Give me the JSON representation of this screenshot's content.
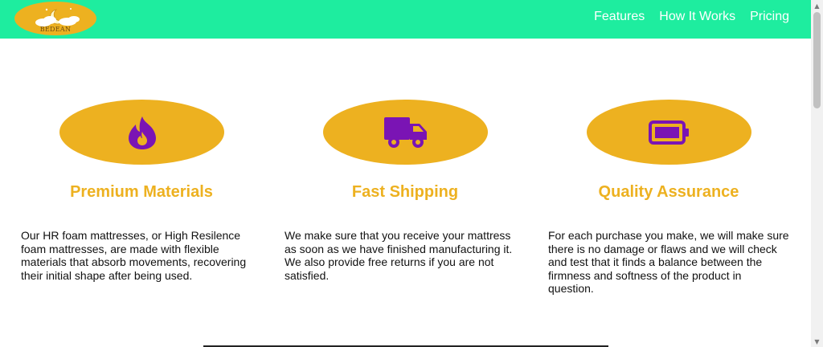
{
  "brand": {
    "logo_text": "BEDEAN",
    "logo_icon": "moon-clouds-logo-icon",
    "colors": {
      "navbar": "#1eed9f",
      "accent": "#edb120",
      "icon": "#7a14b4"
    }
  },
  "nav": {
    "links": [
      {
        "label": "Features"
      },
      {
        "label": "How It Works"
      },
      {
        "label": "Pricing"
      }
    ]
  },
  "features": [
    {
      "icon": "fire-icon",
      "title": "Premium Materials",
      "description": "Our HR foam mattresses, or High Resilence foam mattresses, are made with flexible materials that absorb movements, recovering their initial shape after being used."
    },
    {
      "icon": "truck-icon",
      "title": "Fast Shipping",
      "description": "We make sure that you receive your mattress as soon as we have finished manufacturing it. We also provide free returns if you are not satisfied."
    },
    {
      "icon": "battery-full-icon",
      "title": "Quality Assurance",
      "description": "For each purchase you make, we will make sure there is no damage or flaws and we will check and test that it finds a balance between the firmness and softness of the product in question."
    }
  ]
}
